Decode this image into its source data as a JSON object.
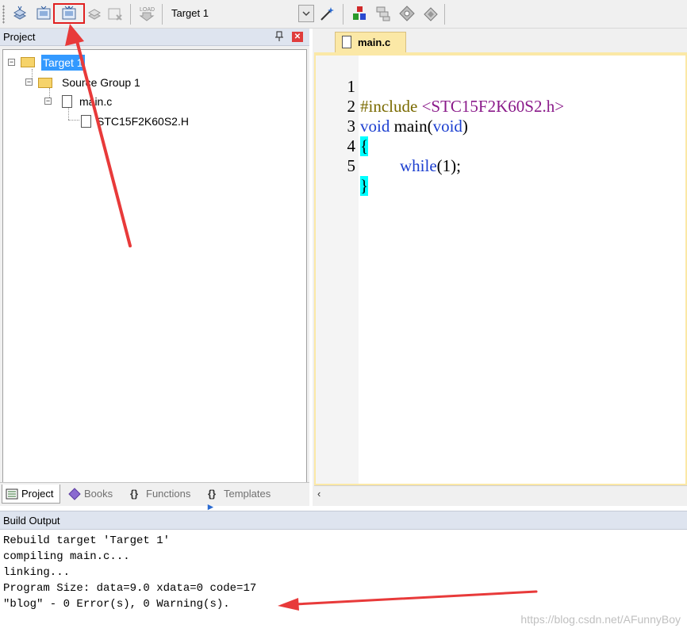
{
  "toolbar": {
    "target_select_value": "Target 1",
    "buttons": [
      "translate-icon",
      "build-icon",
      "rebuild-icon",
      "batch-build-icon",
      "stop-build-icon",
      "download-icon",
      "magic-wand-icon",
      "manage-components-icon",
      "select-packs-icon",
      "options-icon",
      "pack-installer-icon"
    ]
  },
  "project": {
    "title": "Project",
    "tree": {
      "target": "Target 1",
      "group": "Source Group 1",
      "file": "main.c",
      "header": "STC15F2K60S2.H"
    },
    "tabs": [
      {
        "label": "Project",
        "icon": "project-icon"
      },
      {
        "label": "Books",
        "icon": "books-icon"
      },
      {
        "label": "Functions",
        "icon": "functions-icon"
      },
      {
        "label": "Templates",
        "icon": "templates-icon"
      }
    ]
  },
  "editor": {
    "tab_label": "main.c",
    "lines": [
      {
        "n": "1",
        "a": "#include",
        "b": " <STC15F2K60S2.h>"
      },
      {
        "n": "2",
        "a": "void",
        "b": " main(",
        "c": "void",
        "d": ")"
      },
      {
        "n": "3",
        "a": "{"
      },
      {
        "n": "4",
        "a": "while",
        "b": "(1);"
      },
      {
        "n": "5",
        "a": "}"
      }
    ]
  },
  "build": {
    "title": "Build Output",
    "lines": [
      "Rebuild target 'Target 1'",
      "compiling main.c...",
      "linking...",
      "Program Size: data=9.0 xdata=0 code=17",
      "\"blog\" - 0 Error(s), 0 Warning(s)."
    ],
    "watermark": "https://blog.csdn.net/AFunnyBoy"
  },
  "colors": {
    "highlight": "#e02020",
    "keyword": "#1c3fd0",
    "brace_bg": "#00ffff",
    "selection": "#3399ff"
  }
}
